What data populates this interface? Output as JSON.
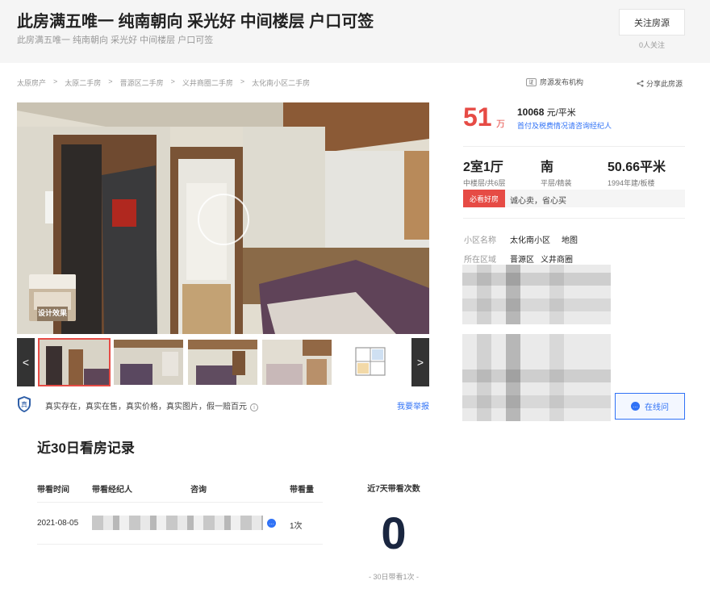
{
  "header": {
    "title": "此房满五唯一 纯南朝向 采光好 中间楼层 户口可签",
    "subtitle": "此房满五唯一 纯南朝向 采光好 中间楼层 户口可签",
    "follow_label": "关注房源",
    "follow_count": "0人关注"
  },
  "breadcrumb": [
    "太原房产",
    "太原二手房",
    "晋源区二手房",
    "义井商圈二手房",
    "太化南小区二手房"
  ],
  "breadcrumb_sep": ">",
  "agency": {
    "icon_text": "证",
    "label": "房源发布机构"
  },
  "share_label": "分享此房源",
  "gallery": {
    "design_label": "设计效果",
    "prev": "<",
    "next": ">"
  },
  "guarantee": {
    "shield_text": "真",
    "text": "真实存在，真实在售，真实价格，真实图片，假一赔百元",
    "info_icon": "i",
    "report_label": "我要举报"
  },
  "viewing": {
    "title": "近30日看房记录",
    "columns": [
      "带看时间",
      "带看经纪人",
      "咨询",
      "带看量"
    ],
    "rows": [
      {
        "date": "2021-08-05",
        "count": "1次"
      }
    ],
    "week_title": "近7天带看次数",
    "week_count": "0",
    "month_note": "- 30日带看1次 -"
  },
  "price": {
    "total": "51",
    "unit": "万",
    "unit_price_value": "10068",
    "unit_price_unit": "元/平米",
    "tax_link": "首付及税费情况请咨询经纪人"
  },
  "specs": [
    {
      "main": "2室1厅",
      "sub": "中楼层/共6层"
    },
    {
      "main": "南",
      "sub": "平层/精装"
    },
    {
      "main": "50.66平米",
      "sub": "1994年建/板楼"
    }
  ],
  "must_see": {
    "badge": "必看好房",
    "text": "诚心卖，省心买"
  },
  "community": {
    "label": "小区名称",
    "name": "太化南小区",
    "map": "地图"
  },
  "area": {
    "label": "所在区域",
    "district": "晋源区",
    "zone": "义井商圈"
  },
  "online_label": "在线问",
  "colors": {
    "accent_red": "#e64b45",
    "link_blue": "#3072f6",
    "dark_navy": "#1a2640"
  }
}
